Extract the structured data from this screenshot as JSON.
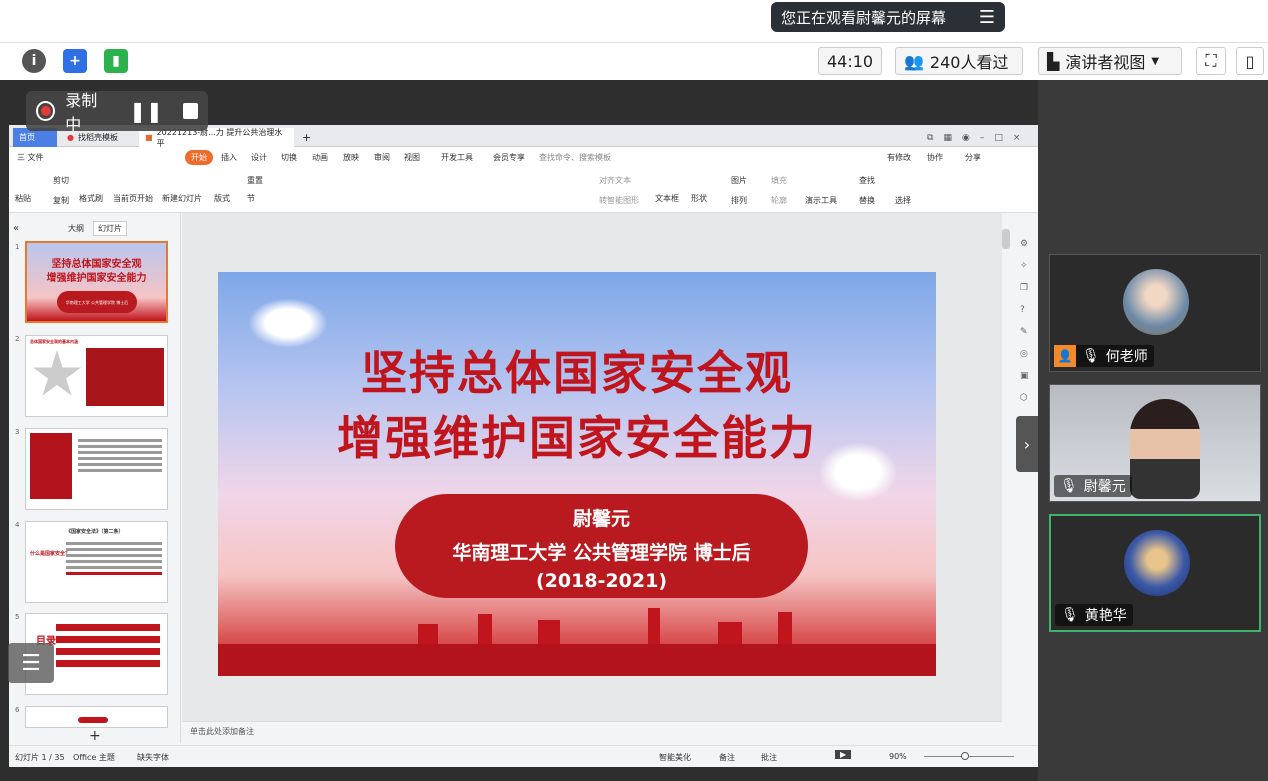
{
  "banner": {
    "text": "您正在观看尉馨元的屏幕",
    "menu_icon": "menu-icon"
  },
  "toolbar": {
    "timer": "44:10",
    "viewers": "240人看过",
    "view_mode": "演讲者视图",
    "icons": [
      "info-icon",
      "shield-icon",
      "signal-icon",
      "fullscreen-icon",
      "sidebar-icon"
    ]
  },
  "recording": {
    "label": "录制中"
  },
  "wps": {
    "tabs": [
      {
        "label": "首页"
      },
      {
        "label": "找稻壳模板"
      },
      {
        "label": "20221213-尉...力 提升公共治理水平"
      }
    ],
    "menu": [
      "三 文件",
      "开始",
      "插入",
      "设计",
      "切换",
      "动画",
      "放映",
      "审阅",
      "视图",
      "开发工具",
      "会员专享",
      "查找命令、搜索模板"
    ],
    "menu_right": [
      "有修改",
      "协作",
      "分享"
    ],
    "ribbon": {
      "paste": "粘贴",
      "cut": "剪切",
      "copy": "复制",
      "format_painter": "格式刷",
      "from_current": "当前页开始",
      "new_slide": "新建幻灯片",
      "layout": "版式",
      "section": "节",
      "reset": "重置",
      "text_box": "文本框",
      "shape": "形状",
      "picture": "图片",
      "arrange": "排列",
      "fill": "填充",
      "outline": "轮廓",
      "presenter": "演示工具",
      "find": "查找",
      "replace": "替换",
      "select": "选择",
      "align_text": "对齐文本",
      "convert_smartart": "转智能图形"
    },
    "panel_tabs": [
      "大纲",
      "幻灯片"
    ],
    "thumb_numbers": [
      "1",
      "2",
      "3",
      "4",
      "5",
      "6"
    ],
    "thumbs": [
      {
        "title1": "坚持总体国家安全观",
        "title2": "增强维护国家安全能力",
        "sub": "华南理工大学 公共管理学院 博士后"
      },
      {
        "title": "总体国家安全观的基本内涵"
      },
      {
        "title": ""
      },
      {
        "title": "《国家安全法》（第二条）",
        "left": "什么是国家安全？"
      },
      {
        "left": "目录"
      },
      {
        "title": ""
      }
    ],
    "notes": "单击此处添加备注",
    "status": {
      "slide": "幻灯片 1 / 35",
      "theme": "Office 主题",
      "font": "缺失字体",
      "beautify": "智能美化",
      "notes": "备注",
      "comments": "批注",
      "zoom": "90%"
    }
  },
  "slide": {
    "title1": "坚持总体国家安全观",
    "title2": "增强维护国家安全能力",
    "name": "尉馨元",
    "affiliation": "华南理工大学 公共管理学院 博士后",
    "years": "(2018-2021)"
  },
  "participants": [
    {
      "name": "何老师",
      "mic": "mic-muted-icon"
    },
    {
      "name": "尉馨元",
      "mic": "mic-icon"
    },
    {
      "name": "黄艳华",
      "mic": "mic-icon"
    }
  ]
}
